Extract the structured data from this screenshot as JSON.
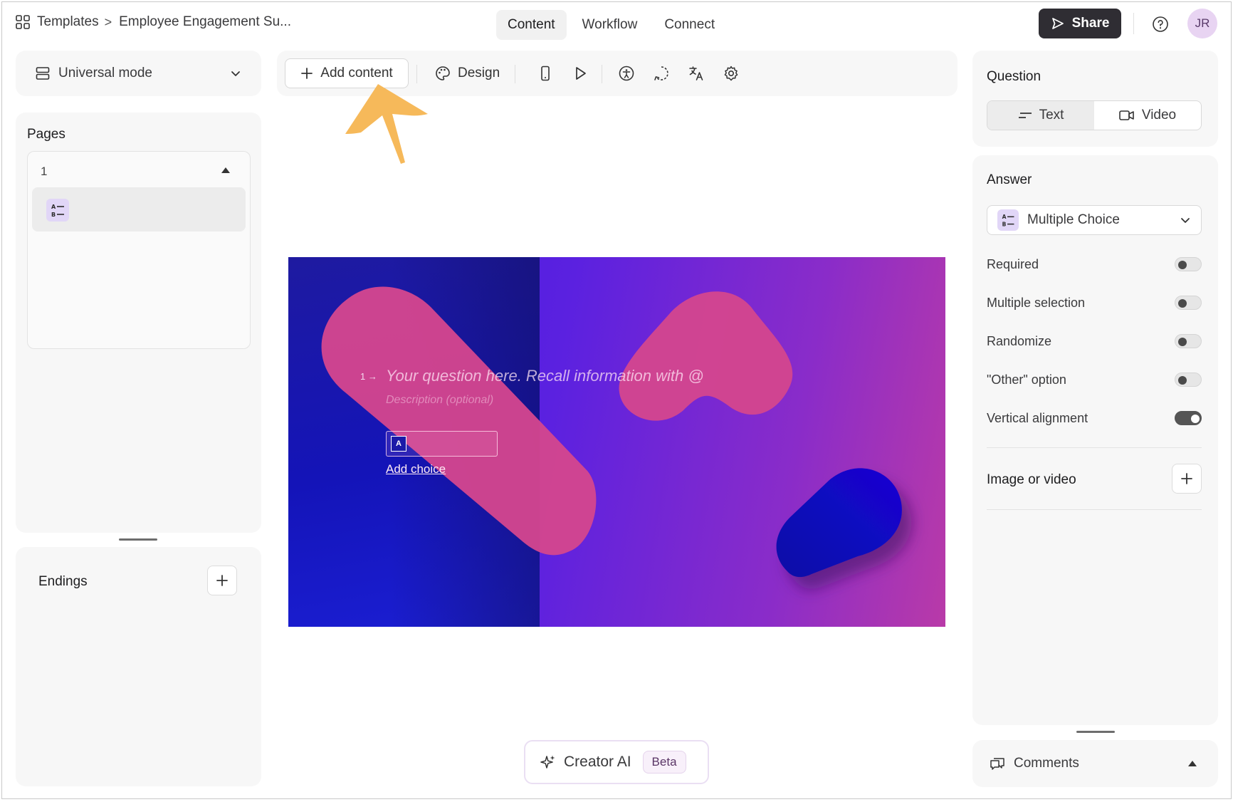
{
  "breadcrumb": {
    "root": "Templates",
    "separator": ">",
    "current": "Employee Engagement Su..."
  },
  "tabs": [
    {
      "label": "Content"
    },
    {
      "label": "Workflow"
    },
    {
      "label": "Connect"
    }
  ],
  "header": {
    "share_label": "Share",
    "avatar_initials": "JR",
    "help_icon": "help-circle-icon"
  },
  "mode": {
    "label": "Universal mode"
  },
  "pages": {
    "title": "Pages",
    "group_number": "1"
  },
  "endings": {
    "title": "Endings"
  },
  "toolbar": {
    "add_content_label": "Add content",
    "design_label": "Design"
  },
  "question": {
    "number": "1",
    "placeholder": "Your question here. Recall information with @",
    "description_placeholder": "Description (optional)",
    "choice_key": "A",
    "add_choice_label": "Add choice"
  },
  "creator": {
    "label": "Creator AI",
    "badge": "Beta"
  },
  "right_panel": {
    "question_title": "Question",
    "segments": [
      {
        "label": "Text"
      },
      {
        "label": "Video"
      }
    ],
    "answer_title": "Answer",
    "answer_type": "Multiple Choice",
    "options": [
      {
        "label": "Required",
        "on": false
      },
      {
        "label": "Multiple selection",
        "on": false
      },
      {
        "label": "Randomize",
        "on": false
      },
      {
        "label": "\"Other\" option",
        "on": false
      },
      {
        "label": "Vertical alignment",
        "on": true
      }
    ],
    "media_title": "Image or video",
    "comments_label": "Comments"
  },
  "colors": {
    "accent_arrow": "#f6b95a",
    "share_bg": "#2f2d33",
    "avatar_bg": "#e8d4f2",
    "shape_pink": "#d3468f",
    "shape_blue": "#1208d0"
  }
}
